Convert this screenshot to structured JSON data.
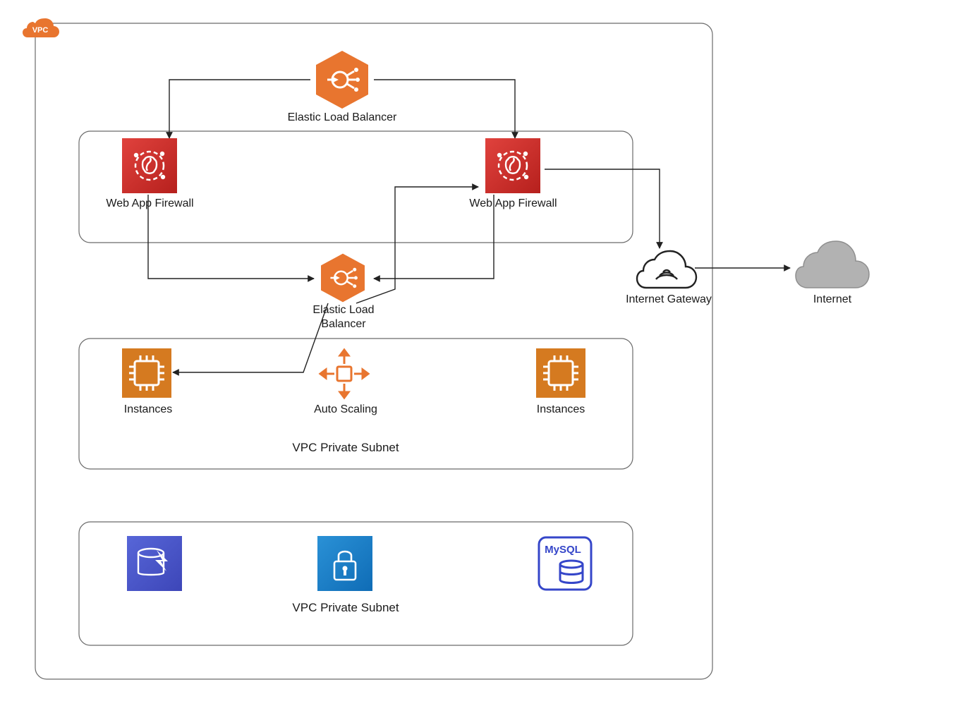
{
  "badge": {
    "text": "VPC"
  },
  "labels": {
    "elb_top": "Elastic Load Balancer",
    "waf_left": "Web App Firewall",
    "waf_right": "Web App Firewall",
    "elb_mid": "Elastic Load\nBalancer",
    "inst_left": "Instances",
    "inst_right": "Instances",
    "autoscale": "Auto Scaling",
    "subnet1": "VPC Private Subnet",
    "subnet2": "VPC Private Subnet",
    "igw": "Internet Gateway",
    "internet": "Internet",
    "mysql": "MySQL"
  },
  "colors": {
    "orange": "#e8752f",
    "orangeDark": "#dc6b26",
    "chipOrange": "#d57a20",
    "red1": "#e0423d",
    "red2": "#b6201d",
    "blue1": "#2a91d6",
    "blue2": "#0f6cb6",
    "blue3": "#1e88c8",
    "purpleBlue": "#5766d8",
    "dbBlue": "#3546c9",
    "gray": "#b2b2b2",
    "boxStroke": "#4b4b4b",
    "thin": "#6a6a6a"
  }
}
